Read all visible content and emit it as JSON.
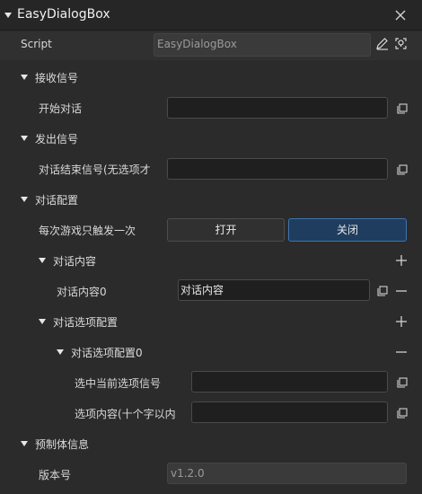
{
  "header": {
    "title": "EasyDialogBox"
  },
  "script_row": {
    "label": "Script",
    "value": "EasyDialogBox"
  },
  "receive": {
    "title": "接收信号",
    "start_label": "开始对话",
    "start_value": ""
  },
  "send": {
    "title": "发出信号",
    "end_label": "对话结束信号(无选项才",
    "end_value": ""
  },
  "config": {
    "title": "对话配置",
    "once_label": "每次游戏只触发一次",
    "on_label": "打开",
    "off_label": "关闭",
    "content": {
      "title": "对话内容",
      "item_label": "对话内容0",
      "item_value": "对话内容"
    },
    "options": {
      "title": "对话选项配置",
      "item_title": "对话选项配置0",
      "select_label": "选中当前选项信号",
      "select_value": "",
      "text_label": "选项内容(十个字以内",
      "text_value": ""
    }
  },
  "prefab": {
    "title": "预制体信息",
    "version_label": "版本号",
    "version_value": "v1.2.0"
  }
}
